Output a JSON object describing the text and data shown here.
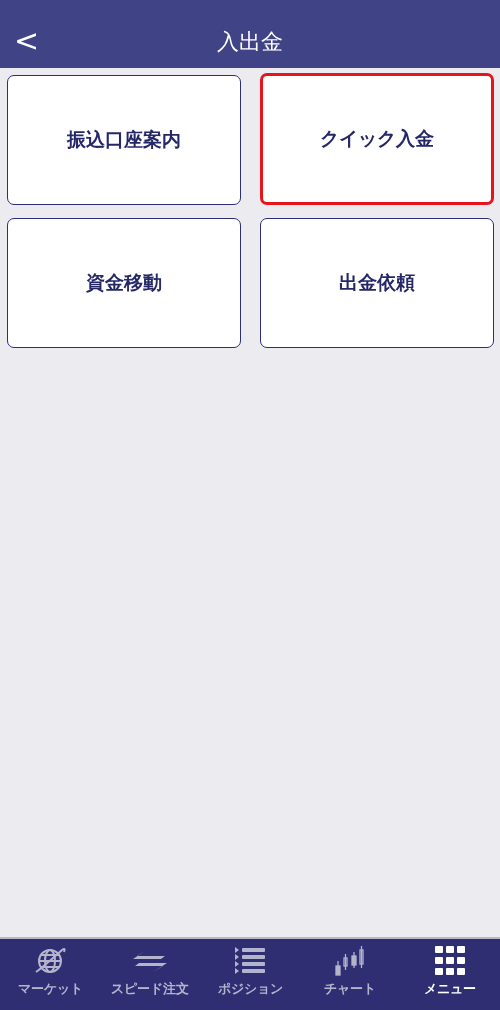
{
  "header": {
    "back": "<",
    "title": "入出金"
  },
  "tiles": [
    {
      "label": "振込口座案内",
      "highlighted": false
    },
    {
      "label": "クイック入金",
      "highlighted": true
    },
    {
      "label": "資金移動",
      "highlighted": false
    },
    {
      "label": "出金依頼",
      "highlighted": false
    }
  ],
  "tab_bar": [
    {
      "kind": "globe",
      "label": "マーケット",
      "selected": false
    },
    {
      "kind": "arrows",
      "label": "スピード注文",
      "selected": false
    },
    {
      "kind": "list",
      "label": "ポジション",
      "selected": false
    },
    {
      "kind": "candles",
      "label": "チャート",
      "selected": false
    },
    {
      "kind": "grid",
      "label": "メニュー",
      "selected": true
    }
  ]
}
